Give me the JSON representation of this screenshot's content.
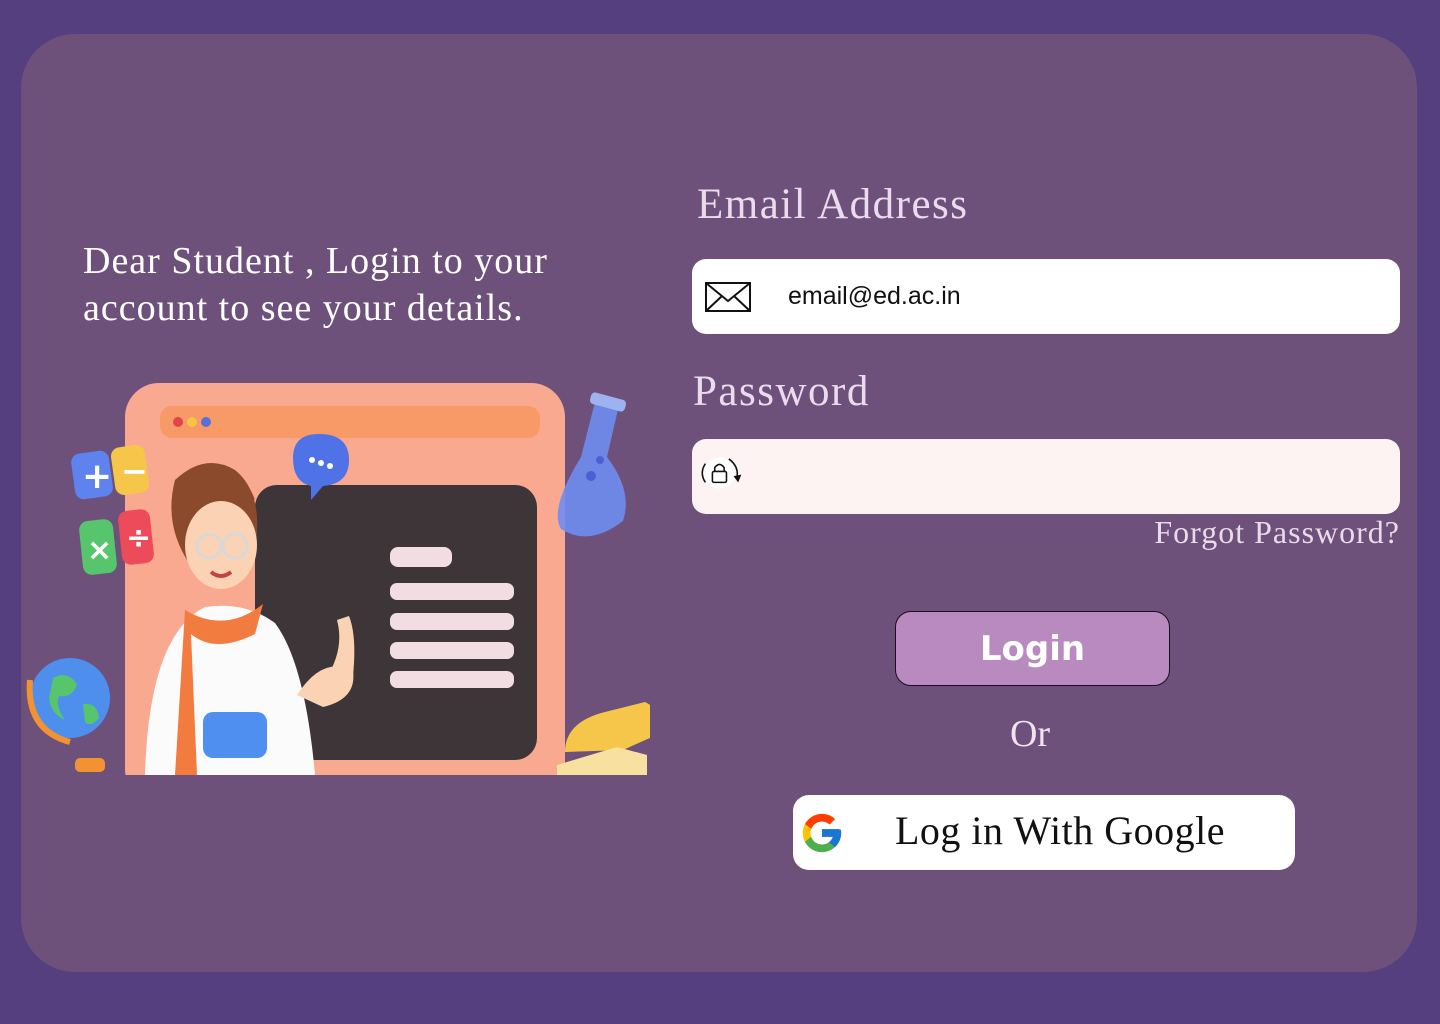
{
  "colors": {
    "page_background": "#563f7e",
    "card_background": "#6d517b",
    "login_button": "#b88abf",
    "field_white": "#ffffff",
    "password_field": "#fdf3f3"
  },
  "intro": {
    "message": "Dear Student , Login to your account to see your details."
  },
  "illustration": {
    "icon": "teacher-at-blackboard-illustration"
  },
  "form": {
    "email_label": "Email Address",
    "email_value": "email@ed.ac.in",
    "email_icon": "envelope-icon",
    "password_label": "Password",
    "password_value": "",
    "password_icon": "lock-refresh-icon",
    "forgot_password": "Forgot Password?",
    "login_button": "Login",
    "or_text": "Or",
    "google_button": "Log in With Google",
    "google_icon": "google-g-icon"
  }
}
